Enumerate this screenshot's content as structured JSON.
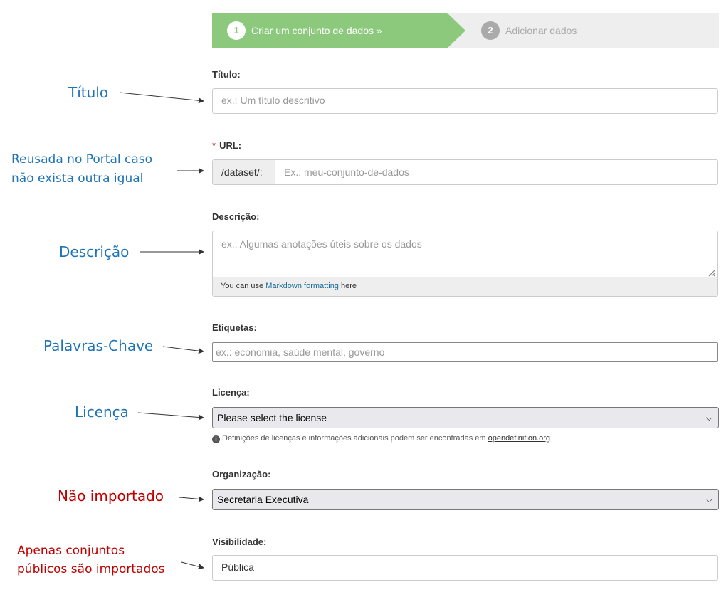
{
  "stepper": {
    "step1": {
      "number": "1",
      "label": "Criar um conjunto de dados »"
    },
    "step2": {
      "number": "2",
      "label": "Adicionar dados"
    }
  },
  "form": {
    "title": {
      "label": "Título:",
      "placeholder": "ex.: Um título descritivo"
    },
    "url": {
      "required_mark": "*",
      "label": "URL:",
      "prefix": "/dataset/:",
      "placeholder": "Ex.: meu-conjunto-de-dados"
    },
    "description": {
      "label": "Descrição:",
      "placeholder": "ex.: Algumas anotações úteis sobre os dados",
      "footer_prefix": "You can use",
      "footer_link": "Markdown formatting",
      "footer_suffix": "here"
    },
    "tags": {
      "label": "Etiquetas:",
      "placeholder": "ex.: economia, saúde mental, governo"
    },
    "license": {
      "label": "Licença:",
      "selected": "Please select the license",
      "help_text": "Definições de licenças e informações adicionais podem ser encontradas em",
      "help_link": "opendefinition.org"
    },
    "organization": {
      "label": "Organização:",
      "selected": "Secretaria Executiva"
    },
    "visibility": {
      "label": "Visibilidade:",
      "value": "Pública"
    }
  },
  "annotations": {
    "title": "Título",
    "url_line1": "Reusada no Portal caso",
    "url_line2": "não exista outra igual",
    "description": "Descrição",
    "tags": "Palavras-Chave",
    "license": "Licença",
    "organization": "Não importado",
    "visibility_line1": "Apenas conjuntos",
    "visibility_line2": "públicos são importados"
  },
  "colors": {
    "step_active": "#8cc97d",
    "annotation_blue": "#1f73b7",
    "annotation_red": "#c00000",
    "link": "#1a6d9b"
  }
}
